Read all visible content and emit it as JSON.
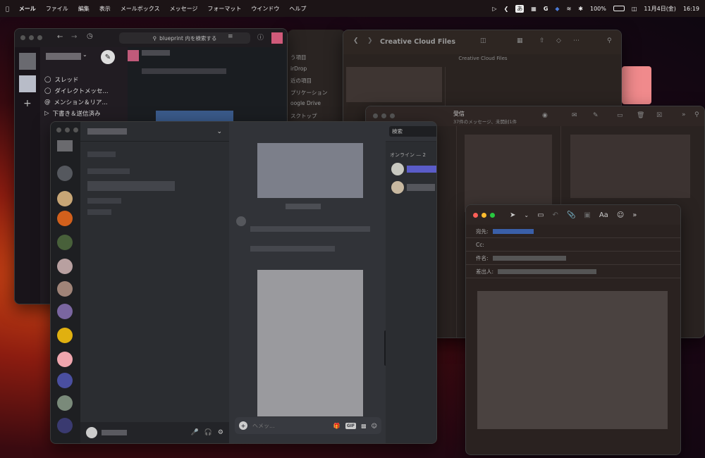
{
  "menubar": {
    "app": "メール",
    "items": [
      "ファイル",
      "編集",
      "表示",
      "メールボックス",
      "メッセージ",
      "フォーマット",
      "ウインドウ",
      "ヘルプ"
    ],
    "battery": "100%",
    "date": "11月4日(金)",
    "time": "16:19",
    "input_mode": "あ",
    "g": "G"
  },
  "slack": {
    "search_placeholder": "blueprint 内を検索する",
    "nav": [
      "スレッド",
      "ダイレクトメッセ...",
      "メンション＆リア...",
      "下書き＆送信済み"
    ],
    "nav_icons": [
      "thread-icon",
      "dm-icon",
      "mention-icon",
      "send-icon"
    ]
  },
  "sidebar_behind": {
    "items": [
      "う項目",
      "irDrop",
      "近の項目",
      "プリケーション",
      "oogle Drive",
      "スクトップ"
    ]
  },
  "finder": {
    "title": "Creative Cloud Files",
    "subtitle": "Creative Cloud Files"
  },
  "mail": {
    "inbox": "受信",
    "count": "37件のメッセージ、未開封1件"
  },
  "discord": {
    "search": "検索",
    "online_header": "オンライン — 2",
    "composer_placeholder": "ヘメッ...",
    "gif": "GIF"
  },
  "compose": {
    "to_label": "宛先:",
    "cc_label": "Cc:",
    "subject_label": "件名:",
    "from_label": "差出人:",
    "format_button": "Aa"
  }
}
